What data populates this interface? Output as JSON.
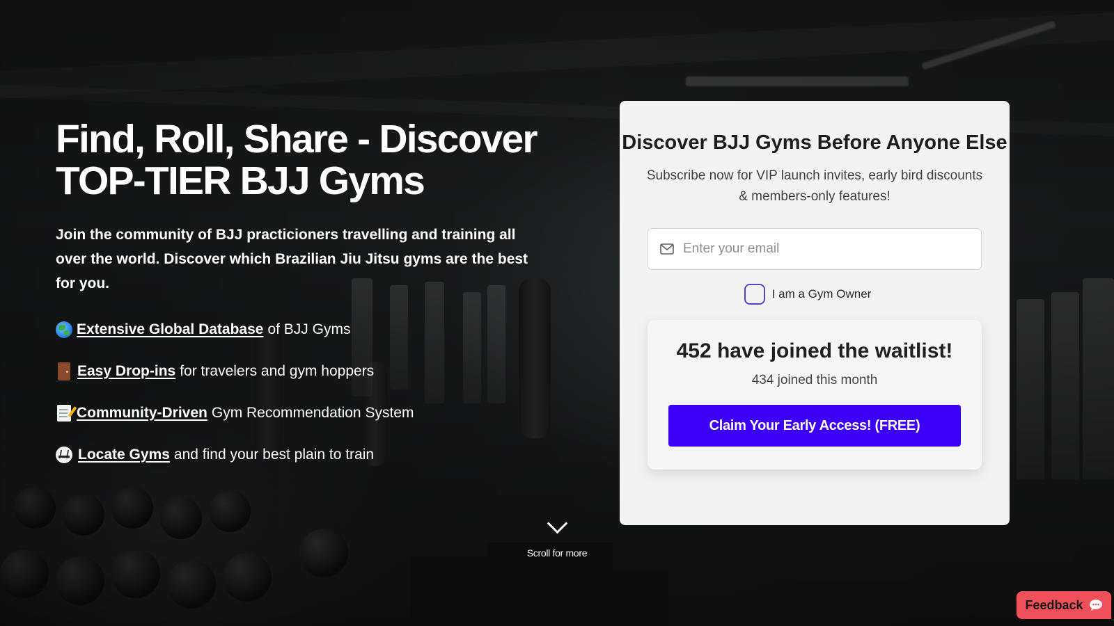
{
  "hero": {
    "title_line1": "Find, Roll, Share - Discover",
    "title_line2": "TOP-TIER BJJ Gyms",
    "subtitle": "Join the community of BJJ practicioners travelling and training all over the world. Discover which Brazilian Jiu Jitsu gyms are the best for you."
  },
  "features": [
    {
      "icon": "globe-icon",
      "link": "Extensive Global Database",
      "text": "of BJJ Gyms"
    },
    {
      "icon": "door-icon",
      "link": "Easy Drop-ins",
      "text": "for travelers and gym hoppers"
    },
    {
      "icon": "memo-icon",
      "link": "Community-Driven",
      "text": "Gym Recommendation System"
    },
    {
      "icon": "martial-arts-uniform-icon",
      "link": "Locate Gyms",
      "text": "and find your best plain to train"
    }
  ],
  "scroll": {
    "label": "Scroll for more",
    "icon": "chevron-down-icon"
  },
  "signup": {
    "title": "Discover BJJ Gyms Before Anyone Else",
    "subtitle": "Subscribe now for VIP launch invites, early bird discounts & members-only features!",
    "email_placeholder": "Enter your email",
    "email_value": "",
    "gym_owner_label": "I am a Gym Owner",
    "gym_owner_checked": false,
    "waitlist_count": "452 have joined the waitlist!",
    "joined_month": "434 joined this month",
    "cta_label": "Claim Your Early Access! (FREE)"
  },
  "feedback": {
    "label": "Feedback",
    "icon": "chat-bubble-icon"
  },
  "colors": {
    "cta": "#3b00f5",
    "feedback": "#f0505a",
    "card_bg": "#f3f3f4",
    "checkbox_border": "#5146c9"
  }
}
